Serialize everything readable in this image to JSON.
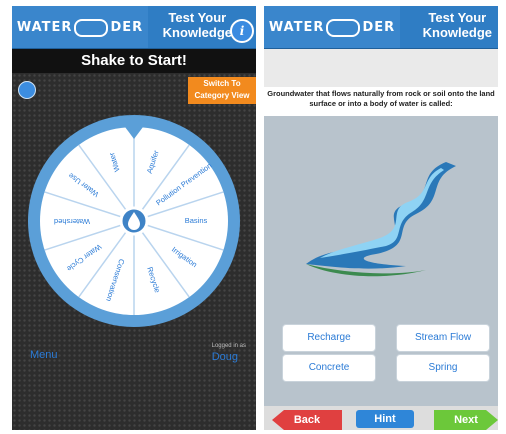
{
  "brand": {
    "logo_left": "WATER",
    "logo_right": "DER"
  },
  "header": {
    "title_line1": "Test Your",
    "title_line2": "Knowledge",
    "info_icon": "i"
  },
  "left_screen": {
    "shake_label": "Shake to Start!",
    "category_button": {
      "line1": "Switch To",
      "line2": "Category View"
    },
    "wheel_segments": [
      "Aquifer",
      "Pollution Prevention",
      "Basins",
      "Irrigation",
      "Recycle",
      "Conservation",
      "Water Cycle",
      "Watershed",
      "Water Use",
      "Water"
    ],
    "menu_label": "Menu",
    "logged_in_label": "Logged in as",
    "user_label": "Doug"
  },
  "right_screen": {
    "question": "Groundwater that flows naturally from rock or soil onto the land surface or into a body of water is called:",
    "answers": [
      "Recharge",
      "Stream Flow",
      "Concrete",
      "Spring"
    ],
    "back_label": "Back",
    "hint_label": "Hint",
    "next_label": "Next"
  },
  "colors": {
    "header_blue": "#2f7dc4",
    "orange": "#f28a1e",
    "back_red": "#e04040",
    "hint_blue": "#2f86d8",
    "next_green": "#6cc83a"
  }
}
